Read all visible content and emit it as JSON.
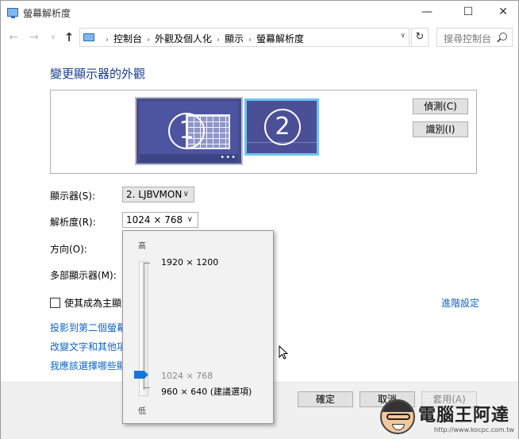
{
  "window": {
    "title": "螢幕解析度",
    "min_glyph": "—",
    "max_glyph": "☐",
    "close_glyph": "✕"
  },
  "nav": {
    "back": "←",
    "forward": "→",
    "recent": "∨",
    "up": "↑",
    "breadcrumbs": [
      "控制台",
      "外觀及個人化",
      "顯示",
      "螢幕解析度"
    ],
    "separator": "›",
    "refresh": "↻",
    "search_placeholder": "搜尋控制台"
  },
  "page": {
    "heading": "變更顯示器的外觀",
    "monitors": [
      {
        "number": "1",
        "active": false
      },
      {
        "number": "2",
        "active": true
      }
    ],
    "monitor_taskbar_dots": "•••",
    "detect_button": "偵測(C)",
    "identify_button": "識別(I)"
  },
  "form": {
    "display_label": "顯示器(S):",
    "display_value": "2. LJBVMON",
    "resolution_label": "解析度(R):",
    "resolution_value": "1024 × 768",
    "orientation_label": "方向(O):",
    "multi_label": "多部顯示器(M):",
    "main_display_checkbox": "使其成為主顯示器",
    "main_display_checked": false,
    "advanced_link": "進階設定",
    "links": [
      "投影到第二個螢幕",
      "改變文字和其他項目",
      "我應該選擇哪些顯示器設定?"
    ],
    "chevron": "∨"
  },
  "resolution_popup": {
    "high_label": "高",
    "low_label": "低",
    "max_resolution": "1920 × 1200",
    "current_resolution": "1024 × 768",
    "recommended_resolution": "960 × 640 (建議選項)",
    "slider_position_fraction": 0.11
  },
  "footer": {
    "ok": "確定",
    "cancel": "取消",
    "apply": "套用(A)"
  },
  "watermark": {
    "text": "電腦王阿達",
    "url": "http://www.kocpc.com.tw"
  },
  "colors": {
    "accent": "#1677d2",
    "link": "#0f63c7",
    "heading": "#1a3e8c",
    "monitor": "#4d55a0",
    "active_border": "#6ec4f0"
  }
}
